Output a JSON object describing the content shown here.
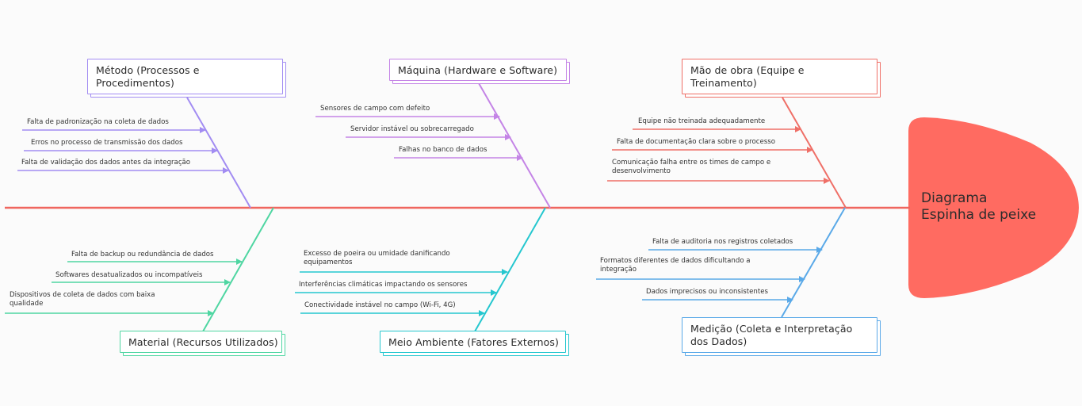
{
  "diagram": {
    "title_line1": "Diagrama",
    "title_line2": "Espinha de peixe",
    "colors": {
      "spine": "#f0665f",
      "head": "#ff6b61",
      "metodo": "#a28cf2",
      "maquina": "#c484e6",
      "mao_de_obra": "#ef6f67",
      "material": "#4fd6a2",
      "meio_ambiente": "#25c7cf",
      "medicao": "#5aa9e8"
    },
    "categories": {
      "metodo": {
        "label": "Método (Processos e Procedimentos)",
        "causes": [
          "Falta de padronização na coleta de dados",
          "Erros no processo de transmissão dos dados",
          "Falta de validação dos dados antes da integração"
        ]
      },
      "maquina": {
        "label": "Máquina (Hardware e Software)",
        "causes": [
          "Sensores de campo com defeito",
          "Servidor instável ou sobrecarregado",
          "Falhas no banco de dados"
        ]
      },
      "mao_de_obra": {
        "label": "Mão de obra (Equipe e Treinamento)",
        "causes": [
          "Equipe não treinada adequadamente",
          "Falta de documentação clara sobre o processo",
          "Comunicação falha entre os times de campo e desenvolvimento"
        ]
      },
      "material": {
        "label": "Material (Recursos Utilizados)",
        "causes": [
          "Falta de backup ou redundância de dados",
          "Softwares desatualizados ou incompatíveis",
          "Dispositivos de coleta de dados com baixa qualidade"
        ]
      },
      "meio_ambiente": {
        "label": "Meio Ambiente (Fatores Externos)",
        "causes": [
          "Excesso de poeira ou umidade danificando equipamentos",
          "Interferências climáticas impactando os sensores",
          "Conectividade instável no campo (Wi-Fi, 4G)"
        ]
      },
      "medicao": {
        "label": "Medição (Coleta e Interpretação dos Dados)",
        "causes": [
          "Falta de auditoria nos registros coletados",
          "Formatos diferentes de dados dificultando a integração",
          "Dados imprecisos ou inconsistentes"
        ]
      }
    }
  }
}
